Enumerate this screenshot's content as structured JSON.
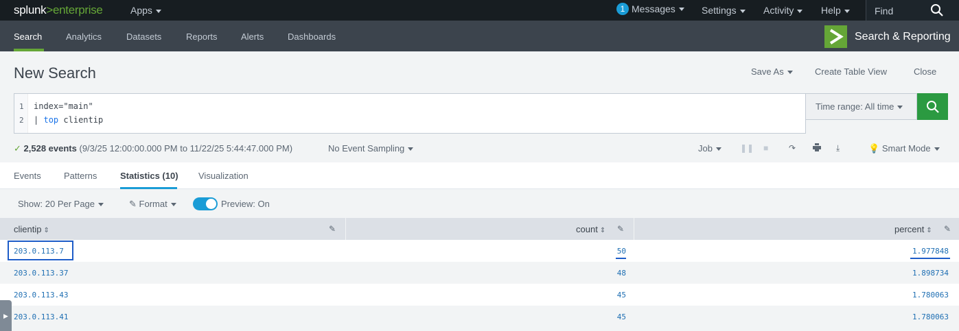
{
  "topbar": {
    "logo_a": "splunk",
    "logo_gt": ">",
    "logo_b": "enterprise",
    "apps_label": "Apps",
    "messages_count": "1",
    "messages_label": "Messages",
    "settings_label": "Settings",
    "activity_label": "Activity",
    "help_label": "Help",
    "find_placeholder": "Find"
  },
  "appnav": {
    "items": [
      "Search",
      "Analytics",
      "Datasets",
      "Reports",
      "Alerts",
      "Dashboards"
    ],
    "active": "Search",
    "app_title": "Search & Reporting"
  },
  "header": {
    "title": "New Search",
    "save_as": "Save As",
    "create_table_view": "Create Table View",
    "close": "Close"
  },
  "search": {
    "line_numbers": [
      "1",
      "2"
    ],
    "line1": "index=\"main\"",
    "line2_pipe": "|",
    "line2_cmd": "top",
    "line2_arg": "clientip",
    "time_range": "Time range: All time"
  },
  "status": {
    "events_count": "2,528 events",
    "events_range": "(9/3/25 12:00:00.000 PM to 11/22/25 5:44:47.000 PM)",
    "sampling": "No Event Sampling",
    "job": "Job",
    "mode": "Smart Mode"
  },
  "tabs": {
    "items": [
      "Events",
      "Patterns",
      "Statistics (10)",
      "Visualization"
    ],
    "active": "Statistics (10)"
  },
  "controls": {
    "per_page": "Show: 20 Per Page",
    "format": "Format",
    "preview": "Preview: On",
    "preview_on": true
  },
  "table": {
    "columns": [
      "clientip",
      "count",
      "percent"
    ],
    "rows": [
      [
        "203.0.113.7",
        "50",
        "1.977848"
      ],
      [
        "203.0.113.37",
        "48",
        "1.898734"
      ],
      [
        "203.0.113.43",
        "45",
        "1.780063"
      ],
      [
        "203.0.113.41",
        "45",
        "1.780063"
      ]
    ]
  },
  "colors": {
    "topbar": "#171d21",
    "appnav": "#3c444d",
    "accent_green": "#65a637",
    "search_button": "#2b9a41",
    "link_blue": "#1f6fb3",
    "tab_underline": "#1a9cd6"
  }
}
